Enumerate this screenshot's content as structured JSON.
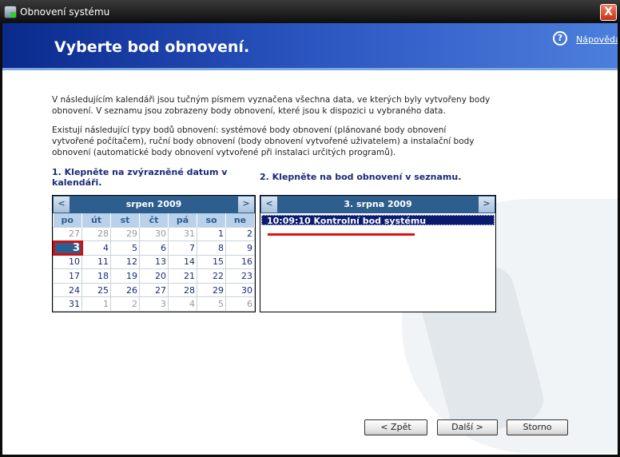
{
  "window": {
    "title": "Obnovení systému",
    "close_label": "X"
  },
  "header": {
    "title": "Vyberte bod obnovení.",
    "help_label": "Nápověda",
    "help_icon": "?"
  },
  "intro": {
    "p1": "V následujícím kalendáři jsou tučným písmem vyznačena všechna data, ve kterých byly vytvořeny body obnovení. V seznamu jsou zobrazeny body obnovení, které jsou k dispozici u vybraného data.",
    "p2": "Existují následující typy bodů obnovení: systémové body obnovení (plánované body obnovení vytvořené počítačem), ruční body obnovení (body obnovení vytvořené uživatelem) a instalační body obnovení (automatické body obnovení vytvořené při instalaci určitých programů)."
  },
  "step1": "1. Klepněte na zvýrazněné datum v kalendáři.",
  "step2": "2. Klepněte na bod obnovení v seznamu.",
  "calendar": {
    "month_label": "srpen 2009",
    "prev": "<",
    "next": ">",
    "weekdays": [
      "po",
      "út",
      "st",
      "čt",
      "pá",
      "so",
      "ne"
    ],
    "selected": "3",
    "weeks": [
      [
        {
          "d": "27",
          "o": true
        },
        {
          "d": "28",
          "o": true
        },
        {
          "d": "29",
          "o": true
        },
        {
          "d": "30",
          "o": true
        },
        {
          "d": "31",
          "o": true
        },
        {
          "d": "1"
        },
        {
          "d": "2"
        }
      ],
      [
        {
          "d": "3",
          "s": true
        },
        {
          "d": "4"
        },
        {
          "d": "5"
        },
        {
          "d": "6"
        },
        {
          "d": "7"
        },
        {
          "d": "8"
        },
        {
          "d": "9"
        }
      ],
      [
        {
          "d": "10"
        },
        {
          "d": "11"
        },
        {
          "d": "12"
        },
        {
          "d": "13"
        },
        {
          "d": "14"
        },
        {
          "d": "15"
        },
        {
          "d": "16"
        }
      ],
      [
        {
          "d": "17"
        },
        {
          "d": "18"
        },
        {
          "d": "19"
        },
        {
          "d": "20"
        },
        {
          "d": "21"
        },
        {
          "d": "22"
        },
        {
          "d": "23"
        }
      ],
      [
        {
          "d": "24"
        },
        {
          "d": "25"
        },
        {
          "d": "26"
        },
        {
          "d": "27"
        },
        {
          "d": "28"
        },
        {
          "d": "29"
        },
        {
          "d": "30"
        }
      ],
      [
        {
          "d": "31"
        },
        {
          "d": "1",
          "o": true
        },
        {
          "d": "2",
          "o": true
        },
        {
          "d": "3",
          "o": true
        },
        {
          "d": "4",
          "o": true
        },
        {
          "d": "5",
          "o": true
        },
        {
          "d": "6",
          "o": true
        }
      ]
    ]
  },
  "restore_list": {
    "date_label": "3. srpna 2009",
    "prev": "<",
    "next": ">",
    "items": [
      {
        "label": "10:09:10  Kontrolní bod systému"
      }
    ]
  },
  "buttons": {
    "back": "< Zpět",
    "next": "Další >",
    "cancel": "Storno"
  }
}
